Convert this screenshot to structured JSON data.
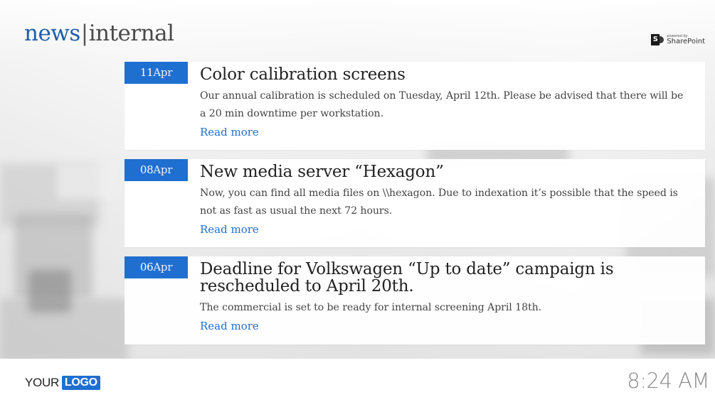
{
  "header": {
    "brand_news": "news",
    "brand_separator": "|",
    "brand_internal": "internal",
    "powered_by_small": "powered by",
    "powered_by_product": "SharePoint",
    "sharepoint_letter": "S"
  },
  "news": [
    {
      "day": "11",
      "month": "Apr",
      "title": "Color calibration screens",
      "text": "Our annual calibration is scheduled on Tuesday, April 12th. Please be advised that there will be a 20 min downtime per workstation.",
      "read_more": "Read more"
    },
    {
      "day": "08",
      "month": "Apr",
      "title": "New media server “Hexagon”",
      "text": "Now, you can find all media files on \\\\hexagon. Due to indexation it’s possible that the speed is not as fast as usual the next 72 hours.",
      "read_more": "Read more"
    },
    {
      "day": "06",
      "month": "Apr",
      "title": "Deadline for Volkswagen “Up to date” campaign is rescheduled to April 20th.",
      "text": "The commercial is set to be ready for internal screening April 18th.",
      "read_more": "Read more"
    }
  ],
  "footer": {
    "logo_your": "YOUR",
    "logo_logo": "LOGO",
    "time": "8:24 AM"
  },
  "colors": {
    "accent": "#1f6fd1",
    "brand": "#1f5ea8"
  }
}
